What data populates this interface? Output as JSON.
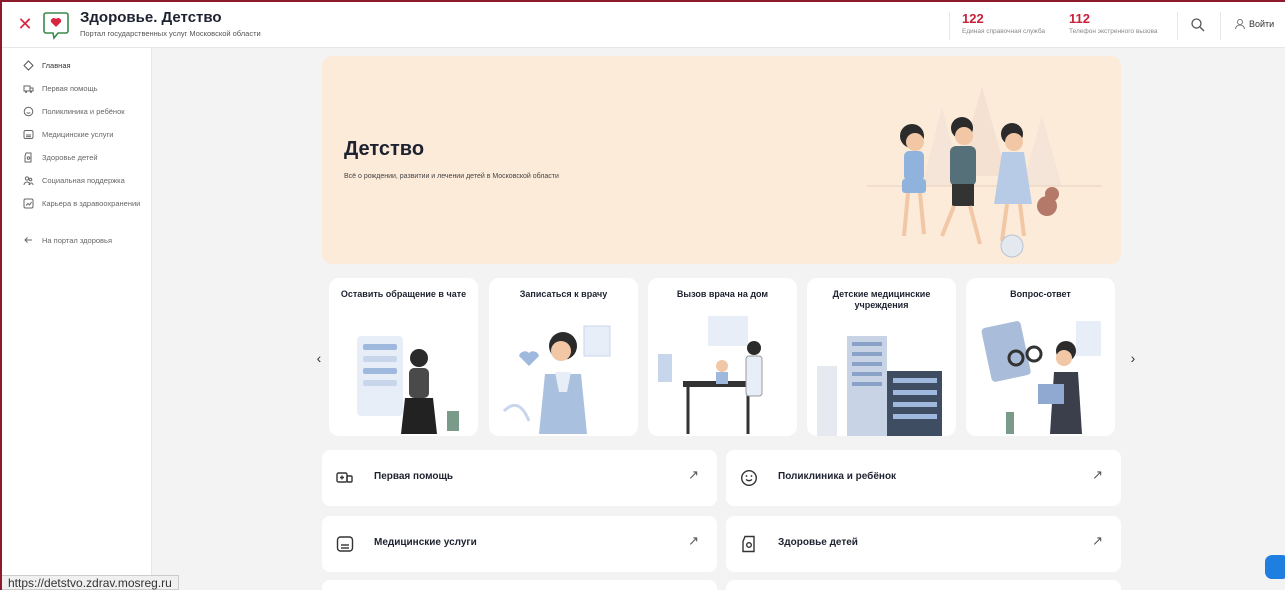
{
  "header": {
    "brand_title": "Здоровье. Детство",
    "brand_subtitle": "Портал государственных услуг Московской области",
    "phones": [
      {
        "number": "122",
        "label": "Единая справочная служба"
      },
      {
        "number": "112",
        "label": "Телефон экстренного вызова"
      }
    ],
    "login_label": "Войти"
  },
  "sidebar": {
    "items": [
      {
        "label": "Главная",
        "icon": "home-icon"
      },
      {
        "label": "Первая помощь",
        "icon": "ambulance-icon"
      },
      {
        "label": "Поликлиника и ребёнок",
        "icon": "baby-face-icon"
      },
      {
        "label": "Медицинские услуги",
        "icon": "medical-card-icon"
      },
      {
        "label": "Здоровье детей",
        "icon": "child-health-icon"
      },
      {
        "label": "Социальная поддержка",
        "icon": "people-icon"
      },
      {
        "label": "Карьера в здравоохранении",
        "icon": "career-icon"
      }
    ],
    "back_link": "На портал здоровья"
  },
  "hero": {
    "title": "Детство",
    "subtitle": "Всё о рождении, развитии и лечении детей в Московской области"
  },
  "cards": [
    {
      "title": "Оставить обращение в чате"
    },
    {
      "title": "Записаться к врачу"
    },
    {
      "title": "Вызов врача на дом"
    },
    {
      "title": "Детские медицинские учреждения"
    },
    {
      "title": "Вопрос-ответ"
    }
  ],
  "tiles": [
    {
      "label": "Первая помощь",
      "icon": "ambulance-icon"
    },
    {
      "label": "Поликлиника и ребёнок",
      "icon": "baby-face-icon"
    },
    {
      "label": "Медицинские услуги",
      "icon": "medical-card-icon"
    },
    {
      "label": "Здоровье детей",
      "icon": "child-health-icon"
    }
  ],
  "status_url": "https://detstvo.zdrav.mosreg.ru",
  "colors": {
    "accent": "#d9263f",
    "hero_bg": "#fdebda",
    "page_bg": "#f3f3f4"
  }
}
